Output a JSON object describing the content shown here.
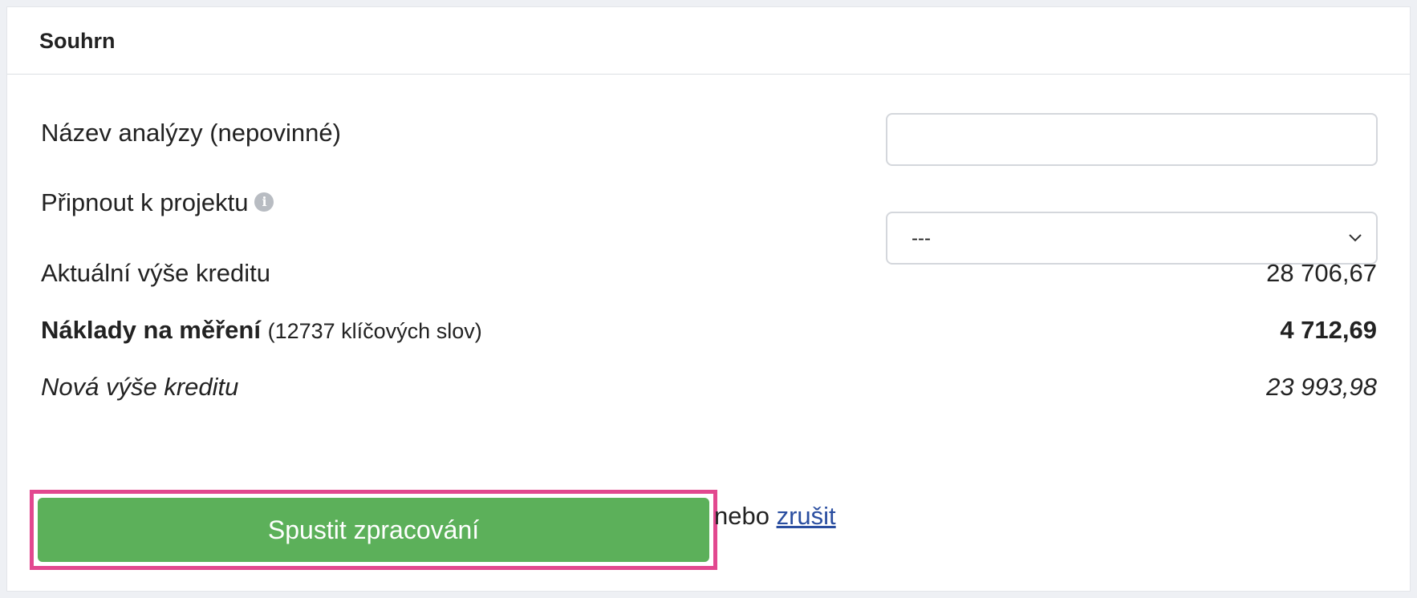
{
  "card": {
    "title": "Souhrn"
  },
  "form": {
    "name_label": "Název analýzy (nepovinné)",
    "name_value": "",
    "name_placeholder": "",
    "project_label": "Připnout k projektu",
    "project_selected": "---",
    "info_glyph": "i"
  },
  "summary": {
    "current_credit_label": "Aktuální výše kreditu",
    "current_credit_value": "28 706,67",
    "cost_label": "Náklady na měření",
    "cost_detail": "(12737 klíčových slov)",
    "cost_value": "4 712,69",
    "new_credit_label": "Nová výše kreditu",
    "new_credit_value": "23 993,98"
  },
  "actions": {
    "run_label": "Spustit zpracování",
    "or_text": "nebo",
    "cancel_label": "zrušit"
  },
  "colors": {
    "primary_button": "#5cb05a",
    "highlight_border": "#e2488f",
    "link": "#2a4ea0"
  },
  "icons": {
    "info": "info-icon",
    "select_arrow": "chevron-down-icon"
  }
}
